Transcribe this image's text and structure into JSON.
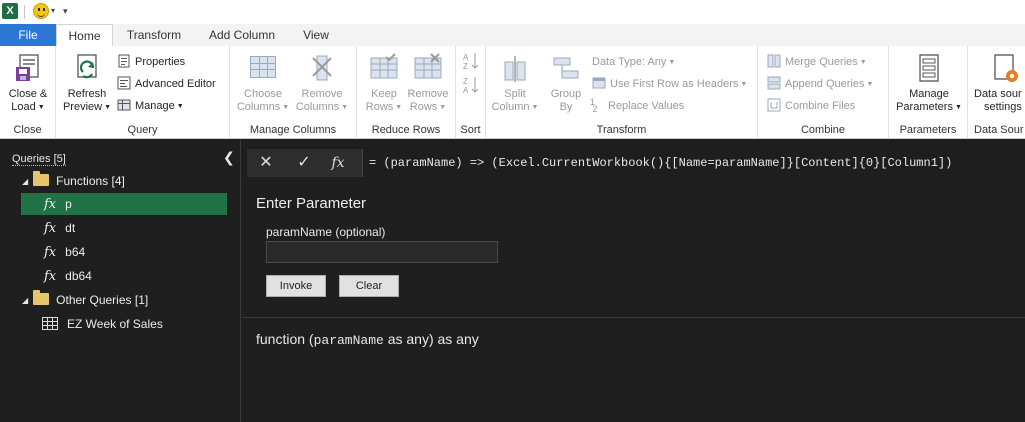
{
  "titlebar": {
    "app_icon": "excel-logo-icon",
    "quick_access": "▾"
  },
  "tabs": [
    {
      "label": "File"
    },
    {
      "label": "Home"
    },
    {
      "label": "Transform"
    },
    {
      "label": "Add Column"
    },
    {
      "label": "View"
    }
  ],
  "ribbon": {
    "close": {
      "button": "Close &",
      "button2": "Load",
      "group": "Close"
    },
    "query": {
      "refresh": "Refresh",
      "refresh2": "Preview",
      "properties": "Properties",
      "advanced_editor": "Advanced Editor",
      "manage": "Manage",
      "group": "Query"
    },
    "manage_columns": {
      "choose": "Choose",
      "choose2": "Columns",
      "remove": "Remove",
      "remove2": "Columns",
      "group": "Manage Columns"
    },
    "reduce_rows": {
      "keep": "Keep",
      "keep2": "Rows",
      "remove": "Remove",
      "remove2": "Rows",
      "group": "Reduce Rows"
    },
    "sort": {
      "group": "Sort"
    },
    "transform": {
      "split": "Split",
      "split2": "Column",
      "group_by": "Group",
      "group_by2": "By",
      "data_type": "Data Type: Any",
      "first_row": "Use First Row as Headers",
      "replace": "Replace Values",
      "group": "Transform"
    },
    "combine": {
      "merge": "Merge Queries",
      "append": "Append Queries",
      "files": "Combine Files",
      "group": "Combine"
    },
    "parameters": {
      "manage": "Manage",
      "manage2": "Parameters",
      "group": "Parameters"
    },
    "data_source": {
      "settings": "Data sour",
      "settings2": "settings",
      "group": "Data Sour"
    }
  },
  "pane": {
    "header": "Queries [5]",
    "folders": [
      {
        "label": "Functions [4]",
        "items": [
          "p",
          "dt",
          "b64",
          "db64"
        ]
      },
      {
        "label": "Other Queries [1]",
        "items": [
          "EZ Week of Sales"
        ]
      }
    ],
    "selected": "p"
  },
  "formula_bar": {
    "fx": "fx",
    "formula": "= (paramName) => (Excel.CurrentWorkbook(){[Name=paramName]}[Content]{0}[Column1])"
  },
  "main": {
    "title": "Enter Parameter",
    "param_label": "paramName (optional)",
    "param_value": "",
    "invoke": "Invoke",
    "clear": "Clear",
    "sig_prefix": "function (",
    "sig_param": "paramName",
    "sig_suffix": " as any) as any"
  },
  "colors": {
    "file_tab": "#2b78d4",
    "selected_row": "#217346",
    "dark_bg": "#1f1f1f"
  }
}
